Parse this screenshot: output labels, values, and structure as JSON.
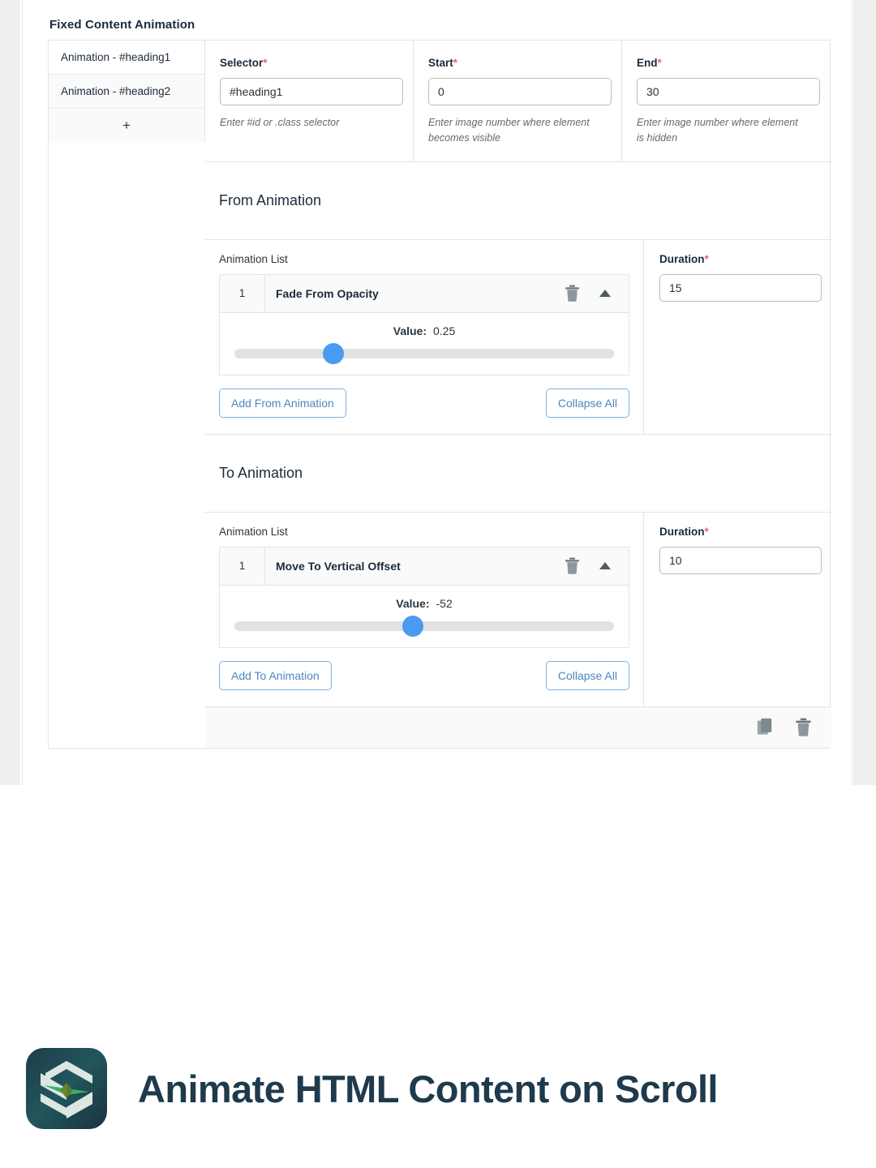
{
  "screenshot": {
    "section_title": "Fixed Content Animation",
    "tabs": [
      {
        "label": "Animation - #heading1",
        "active": true
      },
      {
        "label": "Animation - #heading2",
        "active": false
      }
    ],
    "tab_add_label": "+",
    "fields": {
      "selector": {
        "label": "Selector",
        "required_mark": "*",
        "value": "#heading1",
        "hint": "Enter #id or .class selector"
      },
      "start": {
        "label": "Start",
        "required_mark": "*",
        "value": "0",
        "hint": "Enter image number where element becomes visible"
      },
      "end": {
        "label": "End",
        "required_mark": "*",
        "value": "30",
        "hint": "Enter image number where element is hidden"
      }
    },
    "from_animation": {
      "heading": "From Animation",
      "list_label": "Animation List",
      "row": {
        "index": "1",
        "name": "Fade From Opacity",
        "value_label": "Value:",
        "value": "0.25",
        "slider_percent": 26
      },
      "add_button": "Add From Animation",
      "collapse_button": "Collapse All",
      "duration": {
        "label": "Duration",
        "required_mark": "*",
        "value": "15"
      }
    },
    "to_animation": {
      "heading": "To Animation",
      "list_label": "Animation List",
      "row": {
        "index": "1",
        "name": "Move To Vertical Offset",
        "value_label": "Value:",
        "value": "-52",
        "slider_percent": 47
      },
      "add_button": "Add To Animation",
      "collapse_button": "Collapse All",
      "duration": {
        "label": "Duration",
        "required_mark": "*",
        "value": "10"
      }
    }
  },
  "brand": {
    "title": "Animate HTML Content on Scroll"
  },
  "colors": {
    "accent_blue": "#4a9bf0",
    "button_blue": "#4d87c0",
    "required_red": "#e06c6c",
    "brand_navy": "#1e3a4c",
    "logo_green": "#35b463"
  }
}
